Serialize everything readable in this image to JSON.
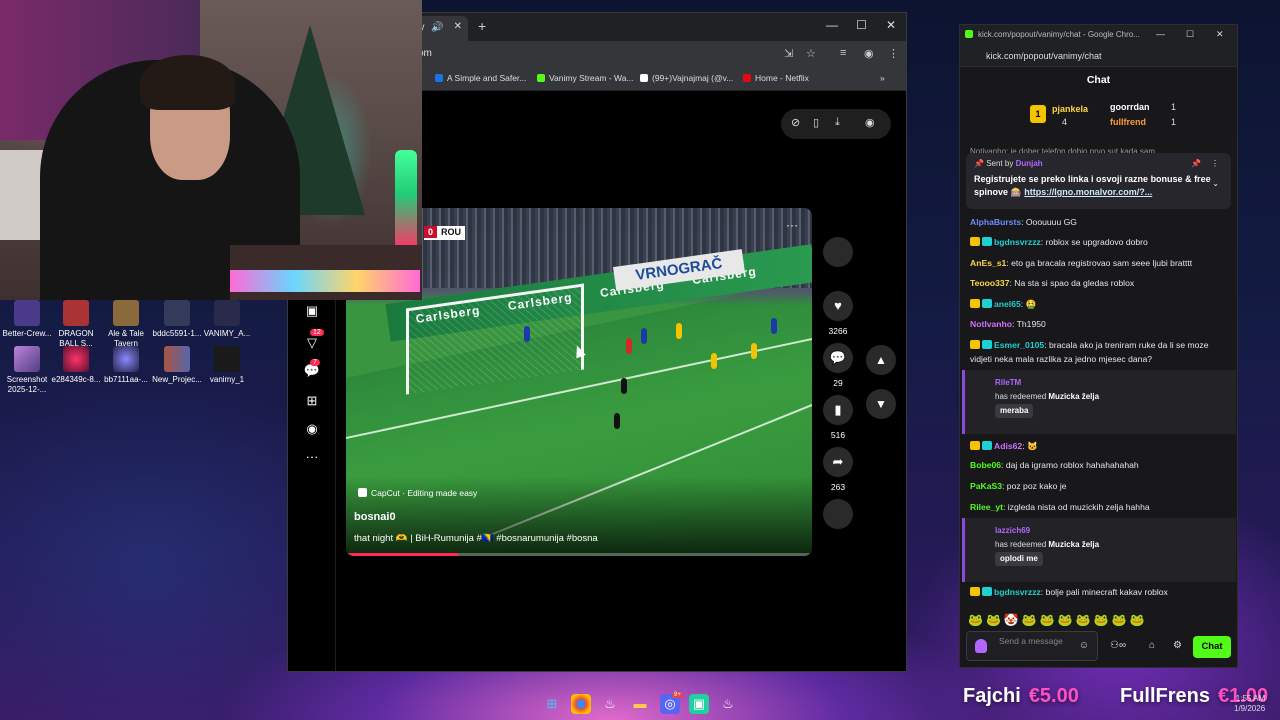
{
  "desktop": {
    "icons_row1": [
      "Better-Crew...",
      "DRAGON BALL S...",
      "Ale & Tale Tavern",
      "bddc5591-1...",
      "VANIMY_A..."
    ],
    "icons_row2": [
      "Screenshot 2025-12-...",
      "e284349c-8...",
      "bb7111aa-...",
      "New_Projec...",
      "vanimy_1"
    ]
  },
  "browser": {
    "tab_title": "ay",
    "url": "om",
    "bookmarks": [
      {
        "label": "A Simple and Safer...",
        "color": "#1a73e8"
      },
      {
        "label": "Vanimy Stream - Wa...",
        "color": "#53fc18"
      },
      {
        "label": "(99+)Vajnajmaj (@v...",
        "color": "#ffffff"
      },
      {
        "label": "Home - Netflix",
        "color": "#e50914"
      }
    ],
    "rail_badges": {
      "inbox": "12",
      "messages": "7"
    },
    "video": {
      "score_left": "0",
      "score_team": "ROU",
      "ad_text": "Carlsberg",
      "board_text": "VRNOGRAČ",
      "capcut": "CapCut · Editing made easy",
      "author": "bosnai0",
      "description": "that night 🫶 | BiH-Rumunija #🇧🇦 #bosnarumunija #bosna",
      "progress": 0.24
    },
    "actions": {
      "likes": "3266",
      "comments": "29",
      "saves": "516",
      "shares": "263"
    }
  },
  "chat": {
    "window_title": "kick.com/popout/vanimy/chat - Google Chro...",
    "url": "kick.com/popout/vanimy/chat",
    "header": "Chat",
    "leaderboard": {
      "first_name": "pjankela",
      "first_rank": "1",
      "first_count": "4",
      "second_name": "goorrdan",
      "second_count": "1",
      "third_name": "fullfrend",
      "third_count": "1"
    },
    "pinned": {
      "top_preview": "Notivanho: je dober telefon dobio prvo sut kada sam ...",
      "sent_by": "Sent by",
      "sender": "Dunjah",
      "text": "Registrujete se preko linka i osvoji razne bonuse & free spinove 🎰",
      "link": "https://lgno.monalvor.com/?..."
    },
    "messages": [
      {
        "user": "AlphaBursts",
        "color": "#6b8cff",
        "text": "Ooouuuu GG"
      },
      {
        "user": "bgdnsvrzzz",
        "color": "#1fd0d0",
        "text": "roblox se upgradovo dobro"
      },
      {
        "user": "AnEs_s1",
        "color": "#ffd54a",
        "text": "eto ga bracala registrovao sam seee ljubi bratttt"
      },
      {
        "user": "Teooo337",
        "color": "#ffd54a",
        "text": "Na sta si spao da gledas roblox"
      },
      {
        "user": "anel65",
        "color": "#1fd0d0",
        "text": "🤮"
      },
      {
        "user": "NotIvanho",
        "color": "#d070ff",
        "text": "Th1950"
      },
      {
        "user": "Esmer_0105",
        "color": "#1fd0d0",
        "text": "bracala ako ja treniram ruke da li se moze vidjeti neka mala razlika za jedno mjesec dana?"
      },
      {
        "user": "Adis62",
        "color": "#d070ff",
        "text": "🐱"
      },
      {
        "user": "Bobe06",
        "color": "#53fc18",
        "text": "daj da igramo roblox hahahahahah"
      },
      {
        "user": "PaKaS3",
        "color": "#53fc18",
        "text": "poz poz kako je"
      },
      {
        "user": "Rilee_yt",
        "color": "#53fc18",
        "text": "izgleda nista od muzickih zelja hahha"
      },
      {
        "user": "bgdnsvrzzz",
        "color": "#1fd0d0",
        "text": "bolje pali minecraft kakav roblox"
      }
    ],
    "redeems": [
      {
        "user": "RileTM",
        "action": "has redeemed",
        "reward": "Muzicka želja",
        "note": "meraba"
      },
      {
        "user": "lazzich69",
        "action": "has redeemed",
        "reward": "Muzicka želja",
        "note": "oplodi me"
      }
    ],
    "input_placeholder": "Send a message",
    "send_label": "Chat"
  },
  "overlay": {
    "donors": [
      {
        "name": "Fajchi",
        "amount": "€5.00"
      },
      {
        "name": "FullFrens",
        "amount": "€1.00"
      }
    ]
  },
  "taskbar": {
    "time": "1:55 AM",
    "date": "1/9/2026",
    "discord_badge": "9+"
  }
}
